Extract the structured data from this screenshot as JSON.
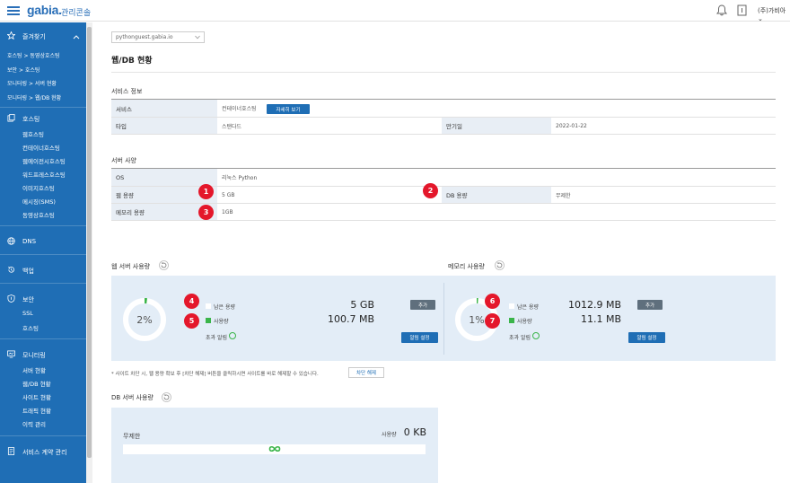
{
  "header": {
    "logo": "gabia.",
    "logo_sub": "관리콘솔",
    "account": "(주)가비아 ⌄"
  },
  "sidebar": {
    "favorites": "즐겨찾기",
    "quick_links": [
      "호스팅 > 동영상호스팅",
      "보안 > 호스팅",
      "모니터링 > 서버 현황",
      "모니터링 > 웹/DB 현황"
    ],
    "hosting": {
      "label": "호스팅",
      "items": [
        "웹호스팅",
        "컨테이너호스팅",
        "웹에이전시호스팅",
        "워드프레스호스팅",
        "이미지호스팅",
        "메시징(SMS)",
        "동영상호스팅"
      ]
    },
    "dns": "DNS",
    "backup": "백업",
    "security": {
      "label": "보안",
      "items": [
        "SSL",
        "호스팅"
      ]
    },
    "monitoring": {
      "label": "모니터링",
      "items": [
        "서버 현황",
        "웹/DB 현황",
        "사이트 현황",
        "트래픽 현황",
        "이력 관리"
      ]
    },
    "contract": "서비스 계약 관리"
  },
  "main": {
    "domain": "pythonguest.gabia.io",
    "title": "웹/DB 현황",
    "service_info": {
      "heading": "서비스 정보",
      "service_label": "서비스",
      "service_value": "컨테이너호스팅",
      "detail_button": "자세히 보기",
      "type_label": "타입",
      "type_value": "스탠다드",
      "expiry_label": "만기일",
      "expiry_value": "2022-01-22"
    },
    "server_spec": {
      "heading": "서버 사양",
      "os_label": "OS",
      "os_value": "리눅스 Python",
      "web_label": "웹 용량",
      "web_value": "5 GB",
      "db_label": "DB 용량",
      "db_value": "무제한",
      "mem_label": "메모리 용량",
      "mem_value": "1GB"
    },
    "web_usage": {
      "heading": "웹 서버 사용량",
      "percent": "2%",
      "percent_value": 2,
      "remain_label": "남은 용량",
      "remain_value": "5 GB",
      "used_label": "사용량",
      "used_value": "100.7 MB",
      "alarm_label": "초과 알림",
      "add_button": "추가",
      "alarm_button": "알림 설정"
    },
    "mem_usage": {
      "heading": "메모리 사용량",
      "percent": "1%",
      "percent_value": 1,
      "remain_label": "남은 용량",
      "remain_value": "1012.9 MB",
      "used_label": "사용량",
      "used_value": "11.1 MB",
      "alarm_label": "초과 알림",
      "add_button": "추가",
      "alarm_button": "알림 설정"
    },
    "note": "* 사이트 차단 시, 웹 용량 확보 후 [차단 해제] 버튼을 클릭하시면 사이트를 바로 해제할 수 있습니다.",
    "unblock_button": "차단 해제",
    "db_usage": {
      "heading": "DB 서버 사용량",
      "limit": "무제한",
      "used_label": "사용량",
      "used_value": "0 KB"
    },
    "markers": [
      "1",
      "2",
      "3",
      "4",
      "5",
      "6",
      "7"
    ]
  },
  "colors": {
    "brand": "#1f6eb5",
    "marker": "#e4172b",
    "used": "#3bb54a",
    "panel": "#e3edf7"
  }
}
